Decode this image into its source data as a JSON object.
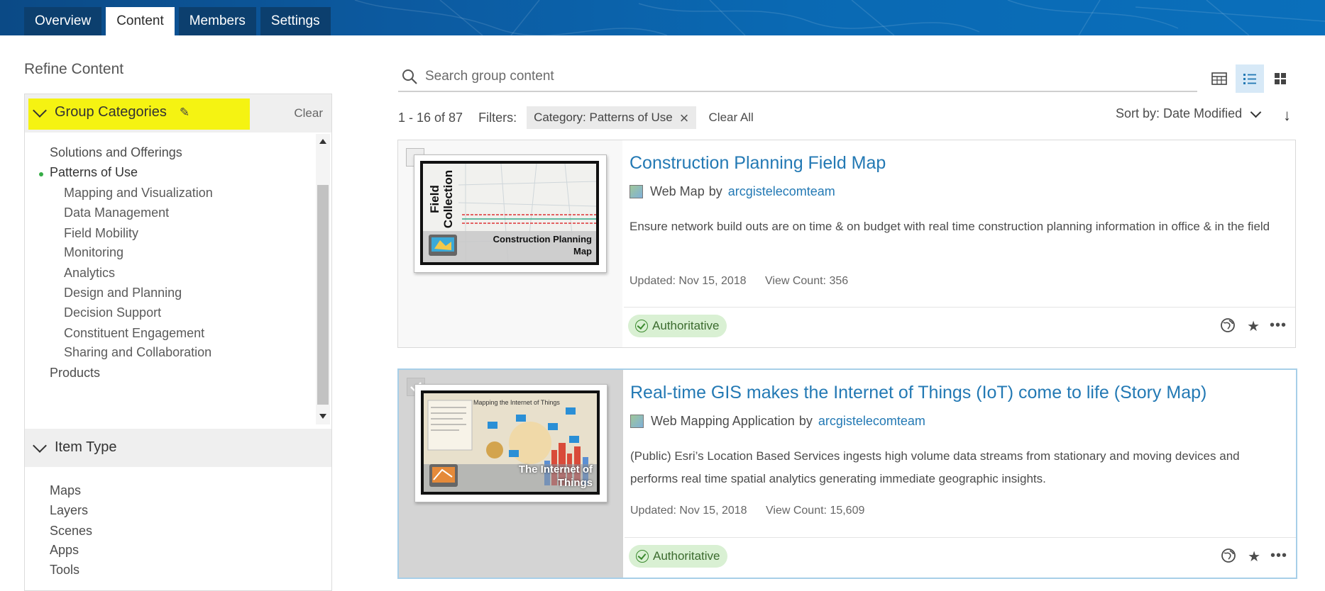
{
  "tabs": [
    {
      "label": "Overview"
    },
    {
      "label": "Content"
    },
    {
      "label": "Members"
    },
    {
      "label": "Settings"
    }
  ],
  "active_tab": "Content",
  "sidebar": {
    "title": "Refine Content",
    "group_categories": {
      "label": "Group Categories",
      "clear_label": "Clear",
      "items": [
        {
          "label": "Solutions and Offerings"
        },
        {
          "label": "Patterns of Use"
        },
        {
          "label": "Mapping and Visualization"
        },
        {
          "label": "Data Management"
        },
        {
          "label": "Field Mobility"
        },
        {
          "label": "Monitoring"
        },
        {
          "label": "Analytics"
        },
        {
          "label": "Design and Planning"
        },
        {
          "label": "Decision Support"
        },
        {
          "label": "Constituent Engagement"
        },
        {
          "label": "Sharing and Collaboration"
        },
        {
          "label": "Products"
        }
      ],
      "selected": "Patterns of Use"
    },
    "item_type": {
      "label": "Item Type",
      "items": [
        {
          "label": "Maps"
        },
        {
          "label": "Layers"
        },
        {
          "label": "Scenes"
        },
        {
          "label": "Apps"
        },
        {
          "label": "Tools"
        }
      ]
    }
  },
  "search": {
    "placeholder": "Search group content"
  },
  "results": {
    "range": "1 - 16 of 87",
    "filters_label": "Filters:",
    "chip": "Category: Patterns of Use",
    "clear_all": "Clear All",
    "sort_label": "Sort by: Date Modified"
  },
  "items": [
    {
      "title": "Construction Planning Field Map",
      "type": "Web Map",
      "by": "by",
      "owner": "arcgistelecomteam",
      "description": "Ensure network build outs are on time & on budget with real time construction planning information in office & in the field",
      "updated": "Updated: Nov 15, 2018",
      "views": "View Count: 356",
      "badge": "Authoritative",
      "thumb_title_1": "Field",
      "thumb_title_2": "Collection",
      "thumb_caption_1": "Construction Planning",
      "thumb_caption_2": "Map"
    },
    {
      "title": "Real-time GIS makes the Internet of Things (IoT) come to life (Story Map)",
      "type": "Web Mapping Application",
      "by": "by",
      "owner": "arcgistelecomteam",
      "description": "(Public) Esri’s Location Based Services ingests high volume data streams from stationary and moving devices and performs real time spatial analytics generating immediate geographic insights.",
      "updated": "Updated: Nov 15, 2018",
      "views": "View Count: 15,609",
      "badge": "Authoritative",
      "thumb_caption_1": "The Internet of",
      "thumb_caption_2": "Things",
      "thumb_small": "Mapping the Internet of Things"
    }
  ],
  "colors": {
    "link": "#2379b4",
    "highlight": "#f5f312",
    "badge_bg": "#d9f0d3",
    "header": "#0c5aa0"
  }
}
